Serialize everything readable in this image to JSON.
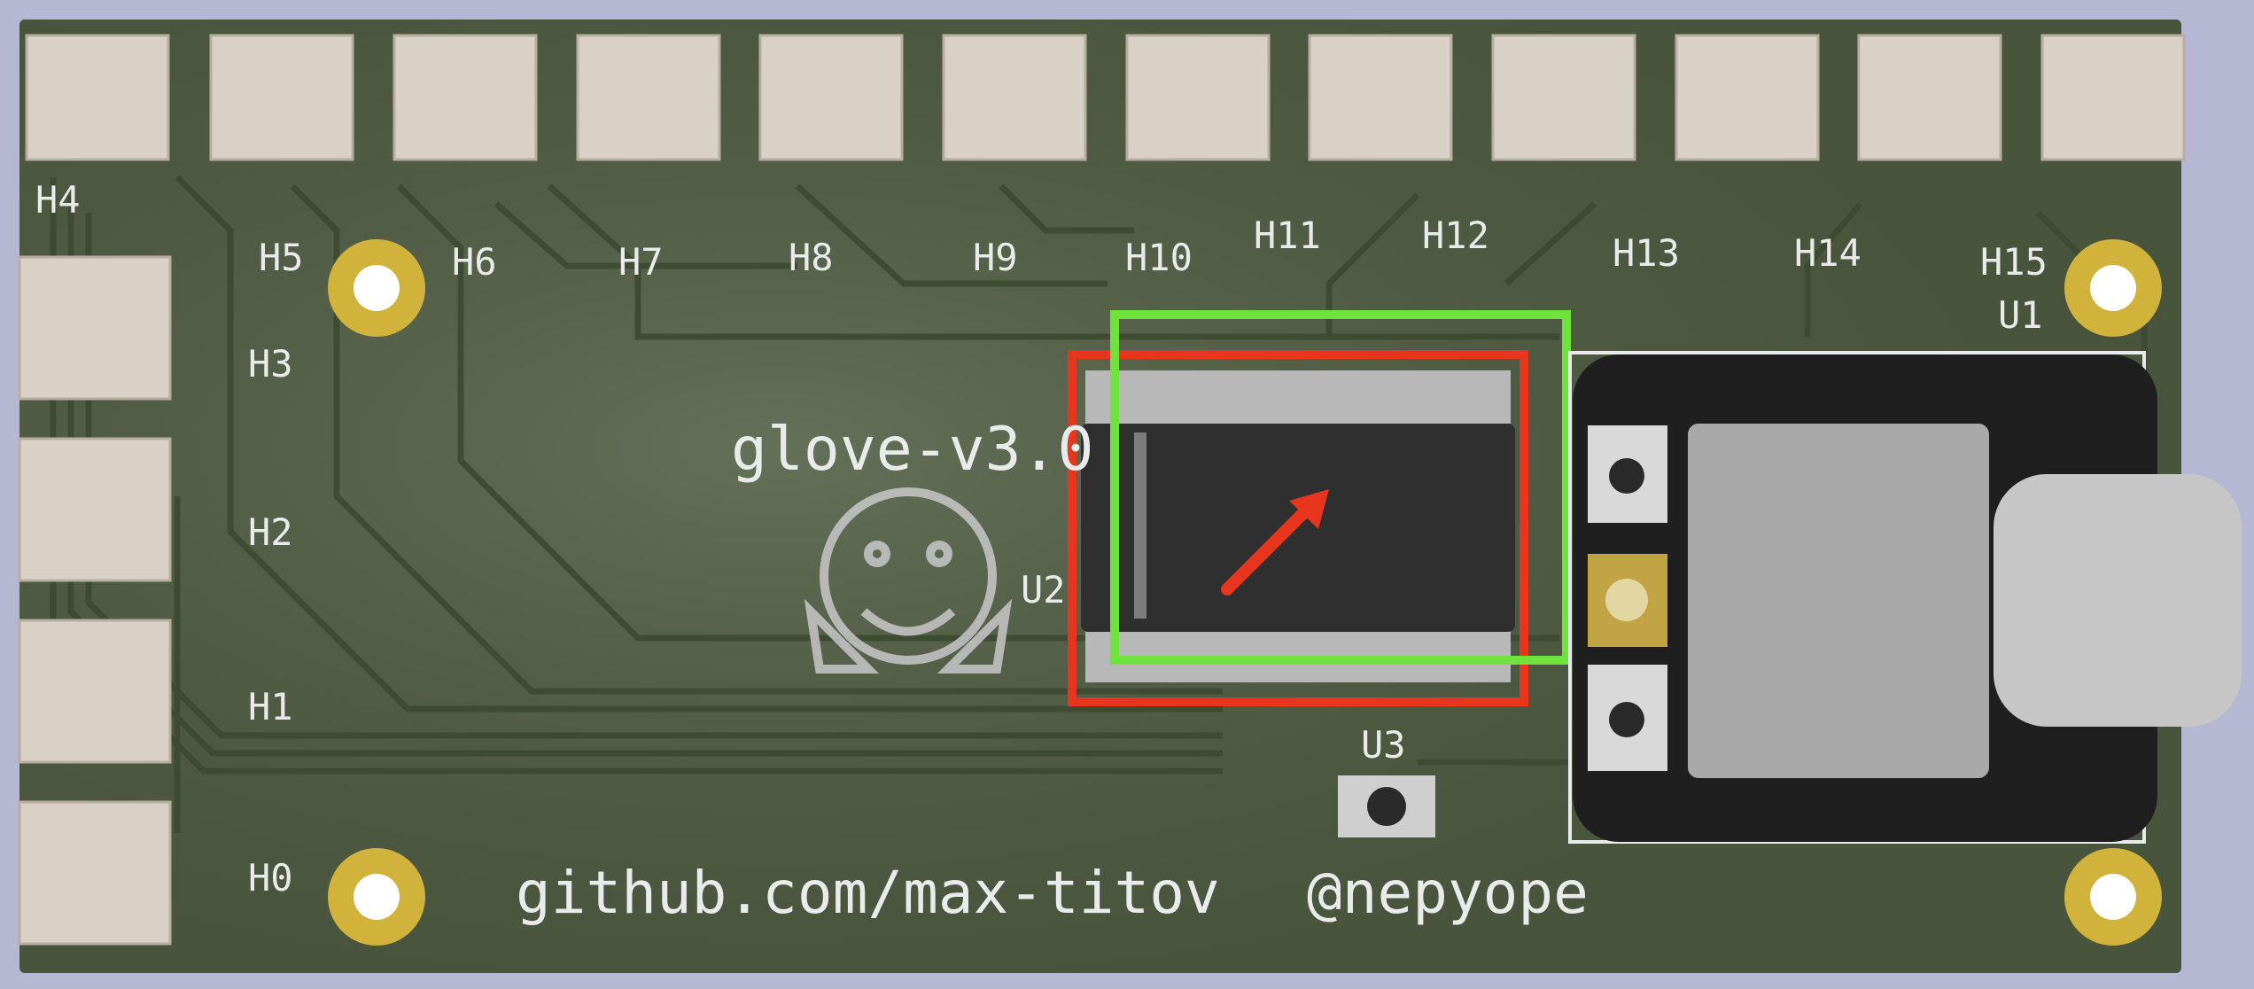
{
  "board": {
    "title": "glove-v3.0",
    "url": "github.com/max-titov",
    "handle": "@nepyope",
    "colors": {
      "background": "#b6b8d3",
      "pcb": "#4a553d",
      "trace": "#3d4a32",
      "silkscreen": "#e9eaea",
      "gold": "#d1b23a",
      "chip": "#2f2f2f",
      "highlight_red": "#e8361e",
      "highlight_green": "#6fe33b"
    }
  },
  "labels": {
    "top": [
      "H4",
      "H5",
      "H6",
      "H7",
      "H8",
      "H9",
      "H10",
      "H11",
      "H12",
      "H13",
      "H14",
      "H15"
    ],
    "left": [
      "H3",
      "H2",
      "H1",
      "H0"
    ],
    "u1": "U1",
    "u2": "U2",
    "u3": "U3"
  },
  "icons": {
    "logo": "hugging-face-emoji-icon",
    "arrow": "red-arrow-icon",
    "usb": "usb-c-connector-icon"
  }
}
